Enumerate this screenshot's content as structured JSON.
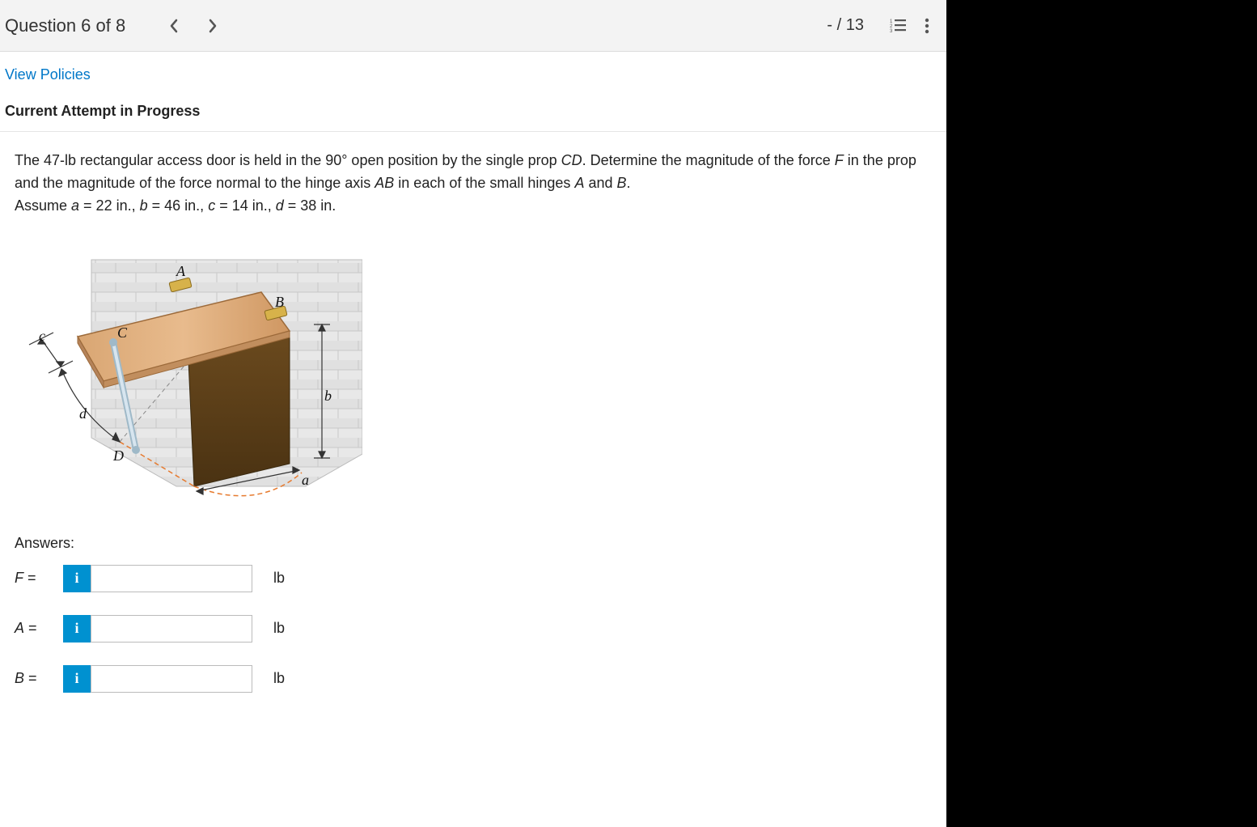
{
  "header": {
    "question_title": "Question 6 of 8",
    "score": "- / 13"
  },
  "links": {
    "view_policies": "View Policies"
  },
  "attempt": {
    "heading": "Current Attempt in Progress"
  },
  "question": {
    "text_1": "The 47-lb rectangular access door is held in the 90° open position by the single prop ",
    "cd": "CD",
    "text_2": ". Determine the magnitude of the force ",
    "f": "F",
    "text_3": " in the prop and the magnitude of the force normal to the hinge axis ",
    "ab": "AB",
    "text_4": " in each of the small hinges ",
    "a": "A",
    "text_5": " and ",
    "b": "B",
    "text_6": ".",
    "assume_prefix": "Assume ",
    "a_eq": "a",
    "a_val": " = 22 in., ",
    "b_eq": "b",
    "b_val": " = 46 in., ",
    "c_eq": "c",
    "c_val": " = 14 in., ",
    "d_eq": "d",
    "d_val": " = 38 in."
  },
  "figure": {
    "labels": {
      "A": "A",
      "B": "B",
      "C": "C",
      "D": "D",
      "a": "a",
      "b": "b",
      "c": "c",
      "d": "d"
    }
  },
  "answers": {
    "heading": "Answers:",
    "rows": [
      {
        "var": "F",
        "eq": " =",
        "unit": "lb",
        "value": ""
      },
      {
        "var": "A",
        "eq": " =",
        "unit": "lb",
        "value": ""
      },
      {
        "var": "B",
        "eq": " =",
        "unit": "lb",
        "value": ""
      }
    ],
    "info_icon": "i"
  }
}
